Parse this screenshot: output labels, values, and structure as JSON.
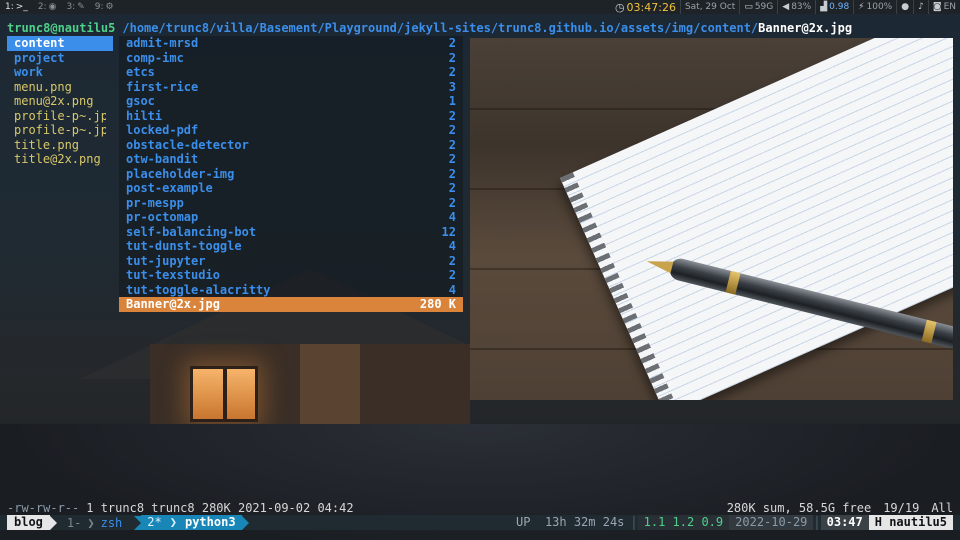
{
  "topbar": {
    "workspaces": [
      {
        "num": "1:",
        "icon": ">_",
        "icon_name": "terminal-icon",
        "active": true
      },
      {
        "num": "2:",
        "icon": "◉",
        "icon_name": "browser-icon",
        "active": false
      },
      {
        "num": "3:",
        "icon": "✎",
        "icon_name": "editor-icon",
        "active": false
      },
      {
        "num": "9:",
        "icon": "⚙",
        "icon_name": "misc-icon",
        "active": false
      }
    ],
    "clock": "03:47:26",
    "date": "Sat, 29 Oct",
    "disk": "59G",
    "volume": "83%",
    "load": "0.98",
    "battery": "100%",
    "keyboard_layout": "EN"
  },
  "ranger": {
    "host": "trunc8@nautilu5",
    "path": "/home/trunc8/villa/Basement/Playground/jekyll-sites/trunc8.github.io/assets/img/content/",
    "current_file": "Banner@2x.jpg",
    "parent_entries": [
      {
        "name": "content",
        "type": "dir",
        "selected": true
      },
      {
        "name": "project",
        "type": "dir",
        "selected": false
      },
      {
        "name": "work",
        "type": "dir",
        "selected": false
      },
      {
        "name": "menu.png",
        "type": "file",
        "selected": false
      },
      {
        "name": "menu@2x.png",
        "type": "file",
        "selected": false
      },
      {
        "name": "profile-p~.jpg",
        "type": "file",
        "selected": false
      },
      {
        "name": "profile-p~.jpg",
        "type": "file",
        "selected": false
      },
      {
        "name": "title.png",
        "type": "file",
        "selected": false
      },
      {
        "name": "title@2x.png",
        "type": "file",
        "selected": false
      }
    ],
    "entries": [
      {
        "name": "admit-mrsd",
        "count": "2"
      },
      {
        "name": "comp-imc",
        "count": "2"
      },
      {
        "name": "etcs",
        "count": "2"
      },
      {
        "name": "first-rice",
        "count": "3"
      },
      {
        "name": "gsoc",
        "count": "1"
      },
      {
        "name": "hilti",
        "count": "2"
      },
      {
        "name": "locked-pdf",
        "count": "2"
      },
      {
        "name": "obstacle-detector",
        "count": "2"
      },
      {
        "name": "otw-bandit",
        "count": "2"
      },
      {
        "name": "placeholder-img",
        "count": "2"
      },
      {
        "name": "post-example",
        "count": "2"
      },
      {
        "name": "pr-mespp",
        "count": "2"
      },
      {
        "name": "pr-octomap",
        "count": "4"
      },
      {
        "name": "self-balancing-bot",
        "count": "12"
      },
      {
        "name": "tut-dunst-toggle",
        "count": "4"
      },
      {
        "name": "tut-jupyter",
        "count": "2"
      },
      {
        "name": "tut-texstudio",
        "count": "2"
      },
      {
        "name": "tut-toggle-alacritty",
        "count": "4"
      }
    ],
    "selected_entry": {
      "name": "Banner@2x.jpg",
      "size": "280 K"
    },
    "status": {
      "permissions": "-rw-rw-r--",
      "info": "1 trunc8 trunc8 280K 2021-09-02 04:42",
      "summary": "280K sum, 58.5G free",
      "position": "19/19",
      "scroll": "All"
    }
  },
  "tmux": {
    "session": "blog",
    "windows": [
      {
        "index": "1-",
        "name": "zsh",
        "active": false
      },
      {
        "index": "2*",
        "name": "python3",
        "active": true
      }
    ],
    "uptime_label": "UP",
    "uptime": "13h 32m 24s",
    "load": "1.1 1.2 0.9",
    "date": "2022-10-29",
    "time": "03:47",
    "host": "H nautilu5"
  }
}
